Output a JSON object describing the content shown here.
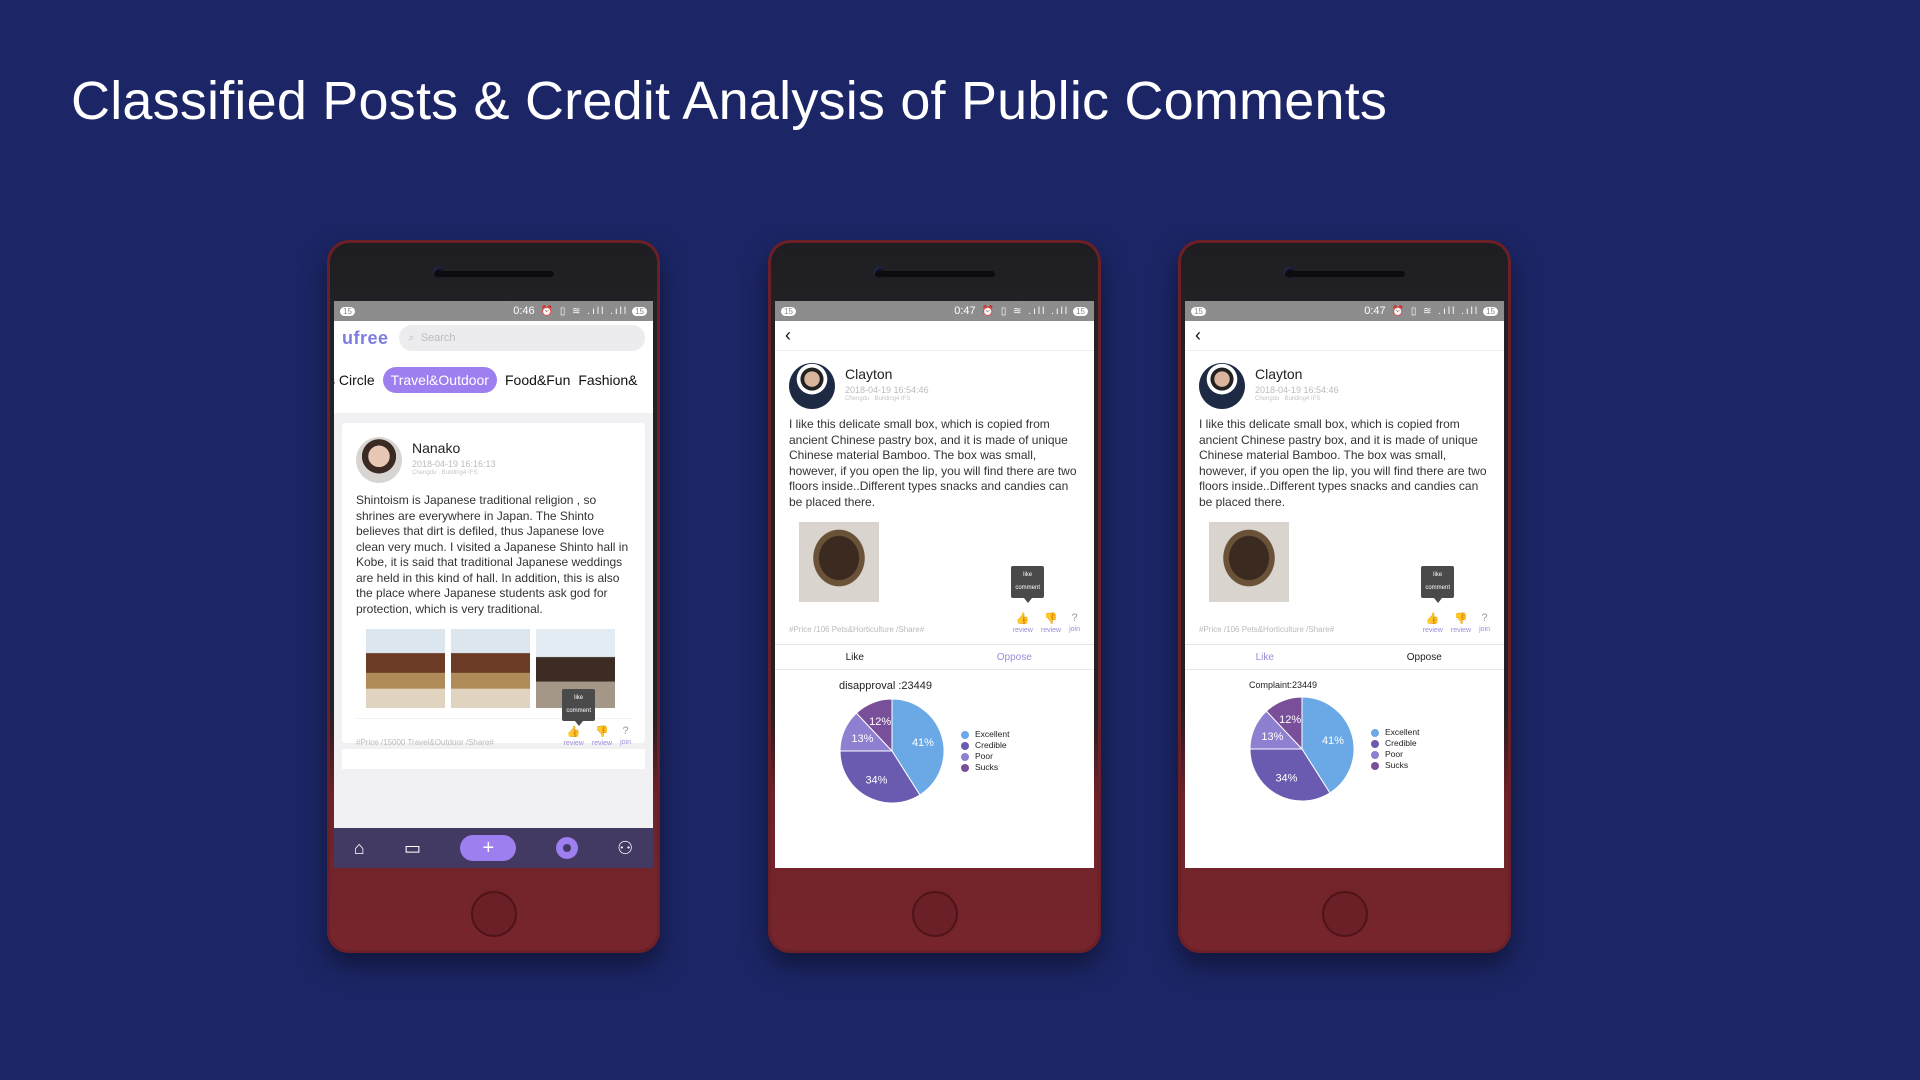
{
  "slide_title": "Classified Posts & Credit Analysis of Public Comments",
  "colors": {
    "background": "#1c2666",
    "accent_purple": "#9e7ff0",
    "nav_bg": "#423a63",
    "pie_blue": "#6aa9e6",
    "pie_indigo": "#6a5ab0",
    "pie_lilac": "#8e7fd0",
    "pie_purple": "#7a4f9a"
  },
  "phone1": {
    "status": {
      "badge": "15",
      "time": "0:46",
      "icons": "⏰ ▯ ≋ .ıll .ıll",
      "battery": "15"
    },
    "logo": "ufree",
    "search_placeholder": "Search",
    "tabs": [
      "s Circle",
      "Travel&Outdoor",
      "Food&Fun",
      "Fashion&"
    ],
    "post": {
      "user": "Nanako",
      "date": "2018-04-19 16:16:13",
      "location": "Chengdu · Building4 IFS",
      "text": "Shintoism is Japanese traditional religion , so shrines are everywhere in Japan. The Shinto believes that dirt is defiled, thus Japanese love clean very much. I visited a Japanese Shinto hall in Kobe, it is said that traditional Japanese weddings are held in this kind of hall. In addition, this is also the place where Japanese students ask god for protection, which is very traditional.",
      "tags": "#Price /15000 Travel&Outdoor /Share#",
      "actions": [
        {
          "icon": "thumb-up-icon",
          "glyph": "👍",
          "label": "review"
        },
        {
          "icon": "thumb-down-icon",
          "glyph": "👎",
          "label": "review"
        },
        {
          "icon": "question-icon",
          "glyph": "?",
          "label": "join"
        }
      ],
      "tooltip": [
        "like",
        "comment"
      ]
    },
    "nav": {
      "home": "⌂",
      "chat": "▭",
      "plus": "+",
      "profile": "⚇"
    }
  },
  "phone2": {
    "status": {
      "badge": "15",
      "time": "0:47",
      "icons": "⏰ ▯ ≋ .ıll .ıll",
      "battery": "15"
    },
    "back": "‹",
    "post": {
      "user": "Clayton",
      "date": "2018-04-19 16:54:46",
      "location": "Chengdu · Building4 IFS",
      "text": "I like this delicate small box, which is copied  from ancient Chinese pastry box, and it is made of unique Chinese material Bamboo. The box was small, however, if you open the lip, you will find there are two floors inside..Different types snacks and candies can be placed there.",
      "tags": "#Price /106 Pets&Horticulture /Share#",
      "actions": [
        {
          "icon": "thumb-up-icon",
          "glyph": "👍",
          "label": "review"
        },
        {
          "icon": "thumb-down-icon",
          "glyph": "👎",
          "label": "review"
        },
        {
          "icon": "question-icon",
          "glyph": "?",
          "label": "join"
        }
      ],
      "tooltip": [
        "like",
        "comment"
      ]
    },
    "split": {
      "left": "Like",
      "right": "Oppose"
    },
    "stat": "disapproval :23449",
    "chart_data": {
      "type": "pie",
      "labels": [
        "Excellent",
        "Credible",
        "Poor",
        "Sucks"
      ],
      "values": [
        41,
        34,
        13,
        12
      ],
      "colors": [
        "#6aa9e6",
        "#6a5ab0",
        "#8e7fd0",
        "#7a4f9a"
      ],
      "legend": [
        "Excellent",
        "Credible",
        "Poor",
        "Sucks"
      ],
      "legend_position": "right"
    }
  },
  "phone3": {
    "status": {
      "badge": "15",
      "time": "0:47",
      "icons": "⏰ ▯ ≋ .ıll .ıll",
      "battery": "15"
    },
    "back": "‹",
    "post": {
      "user": "Clayton",
      "date": "2018-04-19 16:54:46",
      "location": "Chengdu · Building4 IFS",
      "text": "I like this delicate small box, which is copied  from ancient Chinese pastry box, and it is made of unique Chinese material Bamboo. The box was small, however, if you open the lip, you will find there are two floors inside..Different types snacks and candies can be placed there.",
      "tags": "#Price /106 Pets&Horticulture /Share#",
      "actions": [
        {
          "icon": "thumb-up-icon",
          "glyph": "👍",
          "label": "review"
        },
        {
          "icon": "thumb-down-icon",
          "glyph": "👎",
          "label": "review"
        },
        {
          "icon": "question-icon",
          "glyph": "?",
          "label": "join"
        }
      ],
      "tooltip": [
        "like",
        "comment"
      ]
    },
    "split": {
      "left": "Like",
      "right": "Oppose"
    },
    "stat": "Complaint:23449",
    "chart_data": {
      "type": "pie",
      "labels": [
        "Excellent",
        "Credible",
        "Poor",
        "Sucks"
      ],
      "values": [
        41,
        34,
        13,
        12
      ],
      "colors": [
        "#6aa9e6",
        "#6a5ab0",
        "#8e7fd0",
        "#7a4f9a"
      ],
      "legend": [
        "Excellent",
        "Credible",
        "Poor",
        "Sucks"
      ],
      "legend_position": "right"
    }
  }
}
